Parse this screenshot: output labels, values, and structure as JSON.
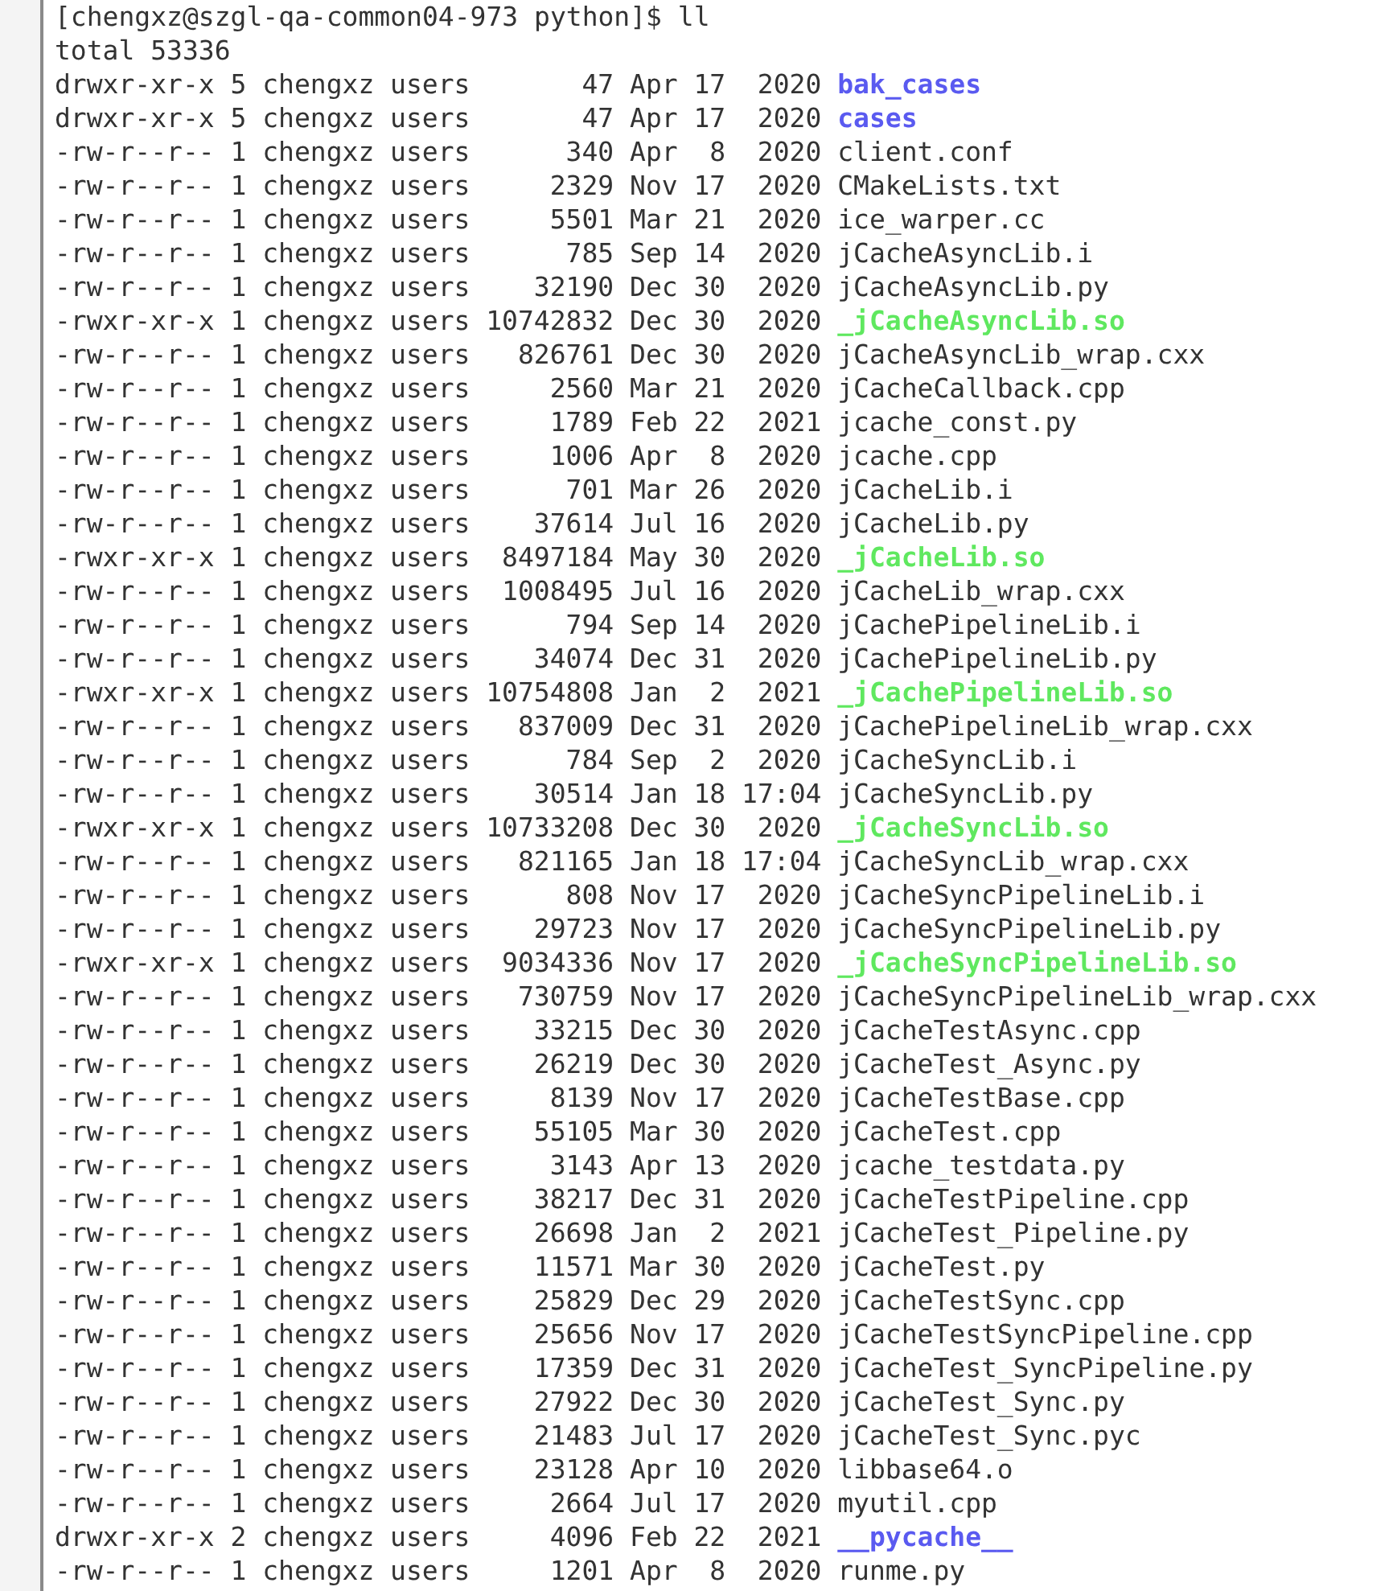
{
  "prompt": {
    "text": "[chengxz@szgl-qa-common04-973 python]$ ll"
  },
  "total": "total 53336",
  "entries": [
    {
      "perms": "drwxr-xr-x",
      "links": "5",
      "owner": "chengxz",
      "group": "users",
      "size": "47",
      "month": "Apr",
      "day": "17",
      "time": "2020",
      "name": "bak_cases",
      "kind": "dir"
    },
    {
      "perms": "drwxr-xr-x",
      "links": "5",
      "owner": "chengxz",
      "group": "users",
      "size": "47",
      "month": "Apr",
      "day": "17",
      "time": "2020",
      "name": "cases",
      "kind": "dir"
    },
    {
      "perms": "-rw-r--r--",
      "links": "1",
      "owner": "chengxz",
      "group": "users",
      "size": "340",
      "month": "Apr",
      "day": "8",
      "time": "2020",
      "name": "client.conf",
      "kind": "file"
    },
    {
      "perms": "-rw-r--r--",
      "links": "1",
      "owner": "chengxz",
      "group": "users",
      "size": "2329",
      "month": "Nov",
      "day": "17",
      "time": "2020",
      "name": "CMakeLists.txt",
      "kind": "file"
    },
    {
      "perms": "-rw-r--r--",
      "links": "1",
      "owner": "chengxz",
      "group": "users",
      "size": "5501",
      "month": "Mar",
      "day": "21",
      "time": "2020",
      "name": "ice_warper.cc",
      "kind": "file"
    },
    {
      "perms": "-rw-r--r--",
      "links": "1",
      "owner": "chengxz",
      "group": "users",
      "size": "785",
      "month": "Sep",
      "day": "14",
      "time": "2020",
      "name": "jCacheAsyncLib.i",
      "kind": "file"
    },
    {
      "perms": "-rw-r--r--",
      "links": "1",
      "owner": "chengxz",
      "group": "users",
      "size": "32190",
      "month": "Dec",
      "day": "30",
      "time": "2020",
      "name": "jCacheAsyncLib.py",
      "kind": "file"
    },
    {
      "perms": "-rwxr-xr-x",
      "links": "1",
      "owner": "chengxz",
      "group": "users",
      "size": "10742832",
      "month": "Dec",
      "day": "30",
      "time": "2020",
      "name": "_jCacheAsyncLib.so",
      "kind": "exec"
    },
    {
      "perms": "-rw-r--r--",
      "links": "1",
      "owner": "chengxz",
      "group": "users",
      "size": "826761",
      "month": "Dec",
      "day": "30",
      "time": "2020",
      "name": "jCacheAsyncLib_wrap.cxx",
      "kind": "file"
    },
    {
      "perms": "-rw-r--r--",
      "links": "1",
      "owner": "chengxz",
      "group": "users",
      "size": "2560",
      "month": "Mar",
      "day": "21",
      "time": "2020",
      "name": "jCacheCallback.cpp",
      "kind": "file"
    },
    {
      "perms": "-rw-r--r--",
      "links": "1",
      "owner": "chengxz",
      "group": "users",
      "size": "1789",
      "month": "Feb",
      "day": "22",
      "time": "2021",
      "name": "jcache_const.py",
      "kind": "file"
    },
    {
      "perms": "-rw-r--r--",
      "links": "1",
      "owner": "chengxz",
      "group": "users",
      "size": "1006",
      "month": "Apr",
      "day": "8",
      "time": "2020",
      "name": "jcache.cpp",
      "kind": "file"
    },
    {
      "perms": "-rw-r--r--",
      "links": "1",
      "owner": "chengxz",
      "group": "users",
      "size": "701",
      "month": "Mar",
      "day": "26",
      "time": "2020",
      "name": "jCacheLib.i",
      "kind": "file"
    },
    {
      "perms": "-rw-r--r--",
      "links": "1",
      "owner": "chengxz",
      "group": "users",
      "size": "37614",
      "month": "Jul",
      "day": "16",
      "time": "2020",
      "name": "jCacheLib.py",
      "kind": "file"
    },
    {
      "perms": "-rwxr-xr-x",
      "links": "1",
      "owner": "chengxz",
      "group": "users",
      "size": "8497184",
      "month": "May",
      "day": "30",
      "time": "2020",
      "name": "_jCacheLib.so",
      "kind": "exec"
    },
    {
      "perms": "-rw-r--r--",
      "links": "1",
      "owner": "chengxz",
      "group": "users",
      "size": "1008495",
      "month": "Jul",
      "day": "16",
      "time": "2020",
      "name": "jCacheLib_wrap.cxx",
      "kind": "file"
    },
    {
      "perms": "-rw-r--r--",
      "links": "1",
      "owner": "chengxz",
      "group": "users",
      "size": "794",
      "month": "Sep",
      "day": "14",
      "time": "2020",
      "name": "jCachePipelineLib.i",
      "kind": "file"
    },
    {
      "perms": "-rw-r--r--",
      "links": "1",
      "owner": "chengxz",
      "group": "users",
      "size": "34074",
      "month": "Dec",
      "day": "31",
      "time": "2020",
      "name": "jCachePipelineLib.py",
      "kind": "file"
    },
    {
      "perms": "-rwxr-xr-x",
      "links": "1",
      "owner": "chengxz",
      "group": "users",
      "size": "10754808",
      "month": "Jan",
      "day": "2",
      "time": "2021",
      "name": "_jCachePipelineLib.so",
      "kind": "exec"
    },
    {
      "perms": "-rw-r--r--",
      "links": "1",
      "owner": "chengxz",
      "group": "users",
      "size": "837009",
      "month": "Dec",
      "day": "31",
      "time": "2020",
      "name": "jCachePipelineLib_wrap.cxx",
      "kind": "file"
    },
    {
      "perms": "-rw-r--r--",
      "links": "1",
      "owner": "chengxz",
      "group": "users",
      "size": "784",
      "month": "Sep",
      "day": "2",
      "time": "2020",
      "name": "jCacheSyncLib.i",
      "kind": "file"
    },
    {
      "perms": "-rw-r--r--",
      "links": "1",
      "owner": "chengxz",
      "group": "users",
      "size": "30514",
      "month": "Jan",
      "day": "18",
      "time": "17:04",
      "name": "jCacheSyncLib.py",
      "kind": "file"
    },
    {
      "perms": "-rwxr-xr-x",
      "links": "1",
      "owner": "chengxz",
      "group": "users",
      "size": "10733208",
      "month": "Dec",
      "day": "30",
      "time": "2020",
      "name": "_jCacheSyncLib.so",
      "kind": "exec"
    },
    {
      "perms": "-rw-r--r--",
      "links": "1",
      "owner": "chengxz",
      "group": "users",
      "size": "821165",
      "month": "Jan",
      "day": "18",
      "time": "17:04",
      "name": "jCacheSyncLib_wrap.cxx",
      "kind": "file"
    },
    {
      "perms": "-rw-r--r--",
      "links": "1",
      "owner": "chengxz",
      "group": "users",
      "size": "808",
      "month": "Nov",
      "day": "17",
      "time": "2020",
      "name": "jCacheSyncPipelineLib.i",
      "kind": "file"
    },
    {
      "perms": "-rw-r--r--",
      "links": "1",
      "owner": "chengxz",
      "group": "users",
      "size": "29723",
      "month": "Nov",
      "day": "17",
      "time": "2020",
      "name": "jCacheSyncPipelineLib.py",
      "kind": "file"
    },
    {
      "perms": "-rwxr-xr-x",
      "links": "1",
      "owner": "chengxz",
      "group": "users",
      "size": "9034336",
      "month": "Nov",
      "day": "17",
      "time": "2020",
      "name": "_jCacheSyncPipelineLib.so",
      "kind": "exec"
    },
    {
      "perms": "-rw-r--r--",
      "links": "1",
      "owner": "chengxz",
      "group": "users",
      "size": "730759",
      "month": "Nov",
      "day": "17",
      "time": "2020",
      "name": "jCacheSyncPipelineLib_wrap.cxx",
      "kind": "file"
    },
    {
      "perms": "-rw-r--r--",
      "links": "1",
      "owner": "chengxz",
      "group": "users",
      "size": "33215",
      "month": "Dec",
      "day": "30",
      "time": "2020",
      "name": "jCacheTestAsync.cpp",
      "kind": "file"
    },
    {
      "perms": "-rw-r--r--",
      "links": "1",
      "owner": "chengxz",
      "group": "users",
      "size": "26219",
      "month": "Dec",
      "day": "30",
      "time": "2020",
      "name": "jCacheTest_Async.py",
      "kind": "file"
    },
    {
      "perms": "-rw-r--r--",
      "links": "1",
      "owner": "chengxz",
      "group": "users",
      "size": "8139",
      "month": "Nov",
      "day": "17",
      "time": "2020",
      "name": "jCacheTestBase.cpp",
      "kind": "file"
    },
    {
      "perms": "-rw-r--r--",
      "links": "1",
      "owner": "chengxz",
      "group": "users",
      "size": "55105",
      "month": "Mar",
      "day": "30",
      "time": "2020",
      "name": "jCacheTest.cpp",
      "kind": "file"
    },
    {
      "perms": "-rw-r--r--",
      "links": "1",
      "owner": "chengxz",
      "group": "users",
      "size": "3143",
      "month": "Apr",
      "day": "13",
      "time": "2020",
      "name": "jcache_testdata.py",
      "kind": "file"
    },
    {
      "perms": "-rw-r--r--",
      "links": "1",
      "owner": "chengxz",
      "group": "users",
      "size": "38217",
      "month": "Dec",
      "day": "31",
      "time": "2020",
      "name": "jCacheTestPipeline.cpp",
      "kind": "file"
    },
    {
      "perms": "-rw-r--r--",
      "links": "1",
      "owner": "chengxz",
      "group": "users",
      "size": "26698",
      "month": "Jan",
      "day": "2",
      "time": "2021",
      "name": "jCacheTest_Pipeline.py",
      "kind": "file"
    },
    {
      "perms": "-rw-r--r--",
      "links": "1",
      "owner": "chengxz",
      "group": "users",
      "size": "11571",
      "month": "Mar",
      "day": "30",
      "time": "2020",
      "name": "jCacheTest.py",
      "kind": "file"
    },
    {
      "perms": "-rw-r--r--",
      "links": "1",
      "owner": "chengxz",
      "group": "users",
      "size": "25829",
      "month": "Dec",
      "day": "29",
      "time": "2020",
      "name": "jCacheTestSync.cpp",
      "kind": "file"
    },
    {
      "perms": "-rw-r--r--",
      "links": "1",
      "owner": "chengxz",
      "group": "users",
      "size": "25656",
      "month": "Nov",
      "day": "17",
      "time": "2020",
      "name": "jCacheTestSyncPipeline.cpp",
      "kind": "file"
    },
    {
      "perms": "-rw-r--r--",
      "links": "1",
      "owner": "chengxz",
      "group": "users",
      "size": "17359",
      "month": "Dec",
      "day": "31",
      "time": "2020",
      "name": "jCacheTest_SyncPipeline.py",
      "kind": "file"
    },
    {
      "perms": "-rw-r--r--",
      "links": "1",
      "owner": "chengxz",
      "group": "users",
      "size": "27922",
      "month": "Dec",
      "day": "30",
      "time": "2020",
      "name": "jCacheTest_Sync.py",
      "kind": "file"
    },
    {
      "perms": "-rw-r--r--",
      "links": "1",
      "owner": "chengxz",
      "group": "users",
      "size": "21483",
      "month": "Jul",
      "day": "17",
      "time": "2020",
      "name": "jCacheTest_Sync.pyc",
      "kind": "file"
    },
    {
      "perms": "-rw-r--r--",
      "links": "1",
      "owner": "chengxz",
      "group": "users",
      "size": "23128",
      "month": "Apr",
      "day": "10",
      "time": "2020",
      "name": "libbase64.o",
      "kind": "file"
    },
    {
      "perms": "-rw-r--r--",
      "links": "1",
      "owner": "chengxz",
      "group": "users",
      "size": "2664",
      "month": "Jul",
      "day": "17",
      "time": "2020",
      "name": "myutil.cpp",
      "kind": "file"
    },
    {
      "perms": "drwxr-xr-x",
      "links": "2",
      "owner": "chengxz",
      "group": "users",
      "size": "4096",
      "month": "Feb",
      "day": "22",
      "time": "2021",
      "name": "__pycache__",
      "kind": "dir"
    },
    {
      "perms": "-rw-r--r--",
      "links": "1",
      "owner": "chengxz",
      "group": "users",
      "size": "1201",
      "month": "Apr",
      "day": "8",
      "time": "2020",
      "name": "runme.py",
      "kind": "file"
    }
  ]
}
